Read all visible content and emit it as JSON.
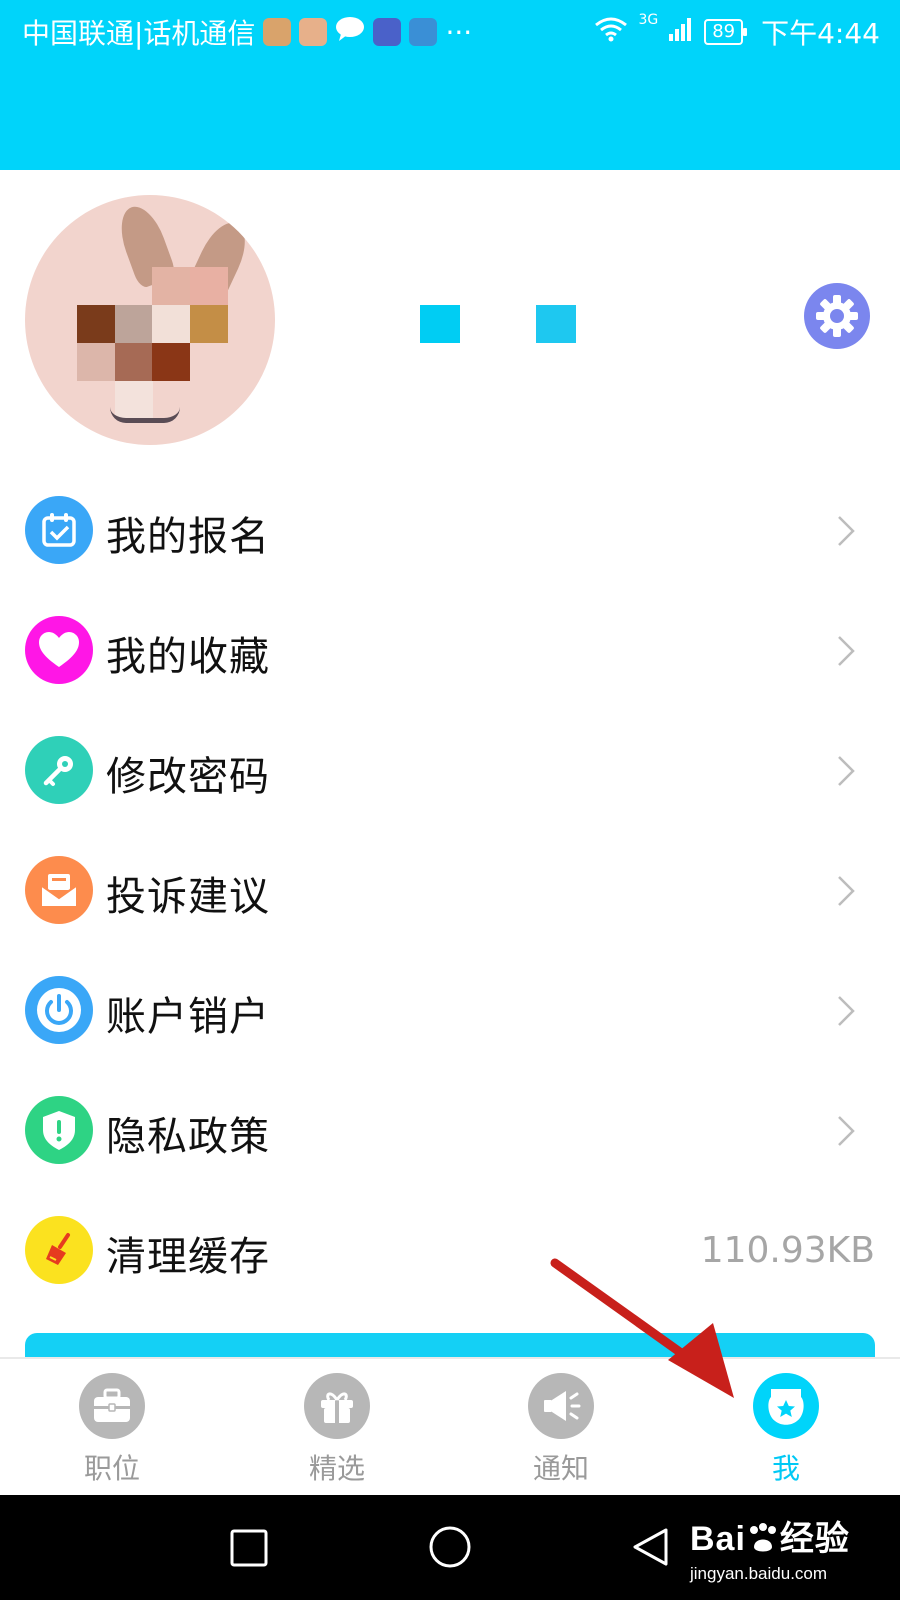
{
  "status_bar": {
    "carrier": "中国联通|话机通信",
    "more": "···",
    "network": "3G",
    "battery": "89",
    "time": "下午4:44"
  },
  "menu": [
    {
      "label": "我的报名",
      "icon": "calendar-check-icon",
      "color": "#3aa7f7"
    },
    {
      "label": "我的收藏",
      "icon": "heart-icon",
      "color": "#ff16e6"
    },
    {
      "label": "修改密码",
      "icon": "key-icon",
      "color": "#2fd0b8"
    },
    {
      "label": "投诉建议",
      "icon": "envelope-icon",
      "color": "#fd8c4d"
    },
    {
      "label": "账户销户",
      "icon": "power-icon",
      "color": "#3aa7f7"
    },
    {
      "label": "隐私政策",
      "icon": "shield-alert-icon",
      "color": "#2ed384"
    },
    {
      "label": "清理缓存",
      "icon": "broom-icon",
      "color": "#fbe21f",
      "value": "110.93KB"
    }
  ],
  "tabs": [
    {
      "label": "职位",
      "icon": "briefcase-icon",
      "active": false
    },
    {
      "label": "精选",
      "icon": "gift-icon",
      "active": false
    },
    {
      "label": "通知",
      "icon": "megaphone-icon",
      "active": false
    },
    {
      "label": "我",
      "icon": "profile-badge-icon",
      "active": true
    }
  ],
  "watermark": {
    "brand": "Bai",
    "brand_suffix": "经验",
    "url": "jingyan.baidu.com"
  },
  "colors": {
    "header": "#00d4fa",
    "settings": "#7b86ee",
    "active_tab": "#00c9f5",
    "inactive_tab": "#b7b7b7",
    "annotation_arrow": "#c8201b"
  }
}
